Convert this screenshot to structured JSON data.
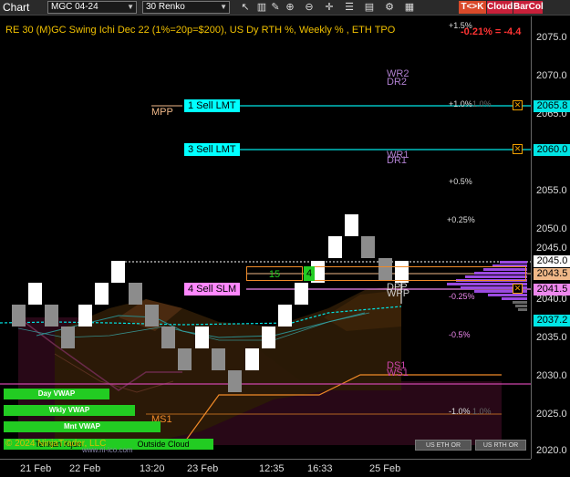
{
  "toolbar": {
    "title": "Chart",
    "instrument": "MGC 04-24",
    "period": "30 Renko",
    "icons": [
      "pointer-icon",
      "bar-style-icon",
      "draw-icon",
      "zoom-in-icon",
      "zoom-out-icon",
      "crosshair-icon",
      "properties-icon",
      "data-box-icon",
      "strategy-icon",
      "chart-trader-icon"
    ],
    "buttons": [
      {
        "label": "T<>K",
        "color": "#d94a2a"
      },
      {
        "label": "Cloud",
        "color": "#c8203a"
      },
      {
        "label": "BarCol",
        "color": "#c8203a"
      }
    ]
  },
  "chart": {
    "title": "RE 30 (M)GC Swing Ichi Dec 22 (1%=20p=$200), US Dy RTH %, Weekly % , ETH TPO",
    "top_pct_left": "+1.5%",
    "top_pct_right": "-0.21% = -4.4",
    "price_ticks": [
      "2075.0",
      "2070.0",
      "2065.0",
      "2060.0",
      "2055.0",
      "2050.0",
      "2045.0",
      "2040.0",
      "2035.0",
      "2030.0",
      "2025.0",
      "2020.0"
    ],
    "price_flags": [
      {
        "label": "2065.8",
        "bg": "#00e5e5"
      },
      {
        "label": "2060.0",
        "bg": "#00e5e5"
      },
      {
        "label": "2045.0",
        "bg": "#ffffff"
      },
      {
        "label": "2043.5",
        "bg": "#f0b888"
      },
      {
        "label": "2041.5",
        "bg": "#ee88ee"
      },
      {
        "label": "2037.2",
        "bg": "#00e5e5"
      }
    ],
    "time_ticks": [
      "21 Feb",
      "22 Feb",
      "13:20",
      "23 Feb",
      "12:35",
      "16:33",
      "25 Feb"
    ],
    "orders": [
      {
        "label": "1 Sell LMT",
        "bg": "#00ffff"
      },
      {
        "label": "3 Sell LMT",
        "bg": "#00ffff"
      },
      {
        "label": "4 Sell SLM",
        "bg": "#ff88ff"
      }
    ],
    "position_qty": "15",
    "position_fill": "4",
    "levels": {
      "mpp": "MPP",
      "wr2": "WR2",
      "dr2": "DR2",
      "wr1": "WR1",
      "dr1_top": "DR1",
      "dpp": "DPP",
      "wpp": "WPP",
      "ds1": "DS1",
      "ws1": "WS1",
      "ms1": "MS1"
    },
    "pct_labels": [
      {
        "text": "+1.0%",
        "dim": "1.0%"
      },
      {
        "text": "+0.5%"
      },
      {
        "text": "+0.25%"
      },
      {
        "text": "-0.25%",
        "color": "#ee88ee"
      },
      {
        "text": "-0.5%",
        "color": "#ee88ee"
      },
      {
        "text": "-1.0%",
        "dim": "1.0%"
      }
    ],
    "vwap_tags": [
      "Day VWAP",
      "Wkly VWAP",
      "Mnt VWAP"
    ],
    "bottom_tags": {
      "tenkan_kijun": "Tenkan Kijun",
      "outside_cloud": "Outside Cloud"
    },
    "copyright": "© 2024 NinjaTrader, LLC",
    "website": "www.ni-ico.com",
    "session_buttons": [
      "US ETH OR",
      "US RTH OR"
    ]
  },
  "colors": {
    "up_bar": "#ffffff",
    "down_bar": "#8c8c8c",
    "title": "#f0c000",
    "cyan": "#00e5e5",
    "magenta": "#ee88ee",
    "orange": "#f08a28",
    "green": "#22cc22"
  }
}
